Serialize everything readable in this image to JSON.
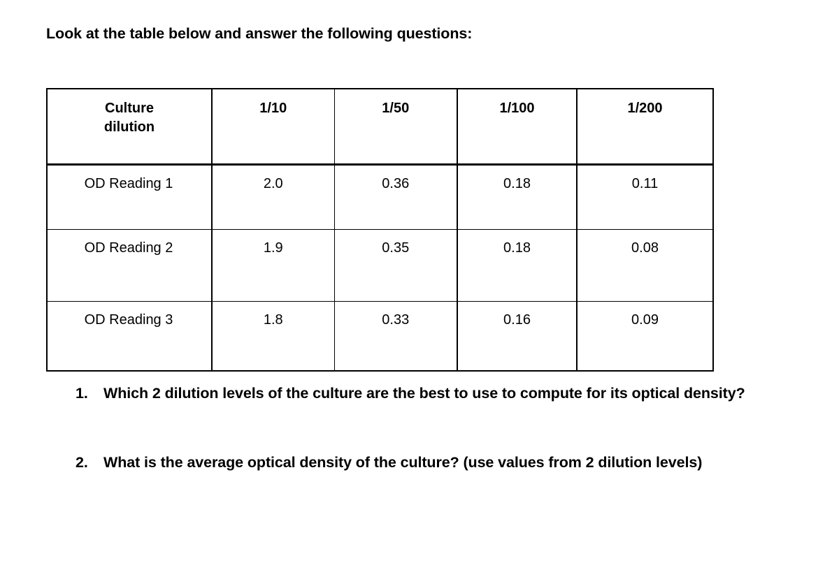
{
  "heading": "Look at the table below and answer the following questions:",
  "table": {
    "columns": [
      "Culture dilution",
      "1/10",
      "1/50",
      "1/100",
      "1/200"
    ],
    "header_col0_line1": "Culture",
    "header_col0_line2": "dilution",
    "rows": [
      {
        "label": "OD Reading 1",
        "values": [
          "2.0",
          "0.36",
          "0.18",
          "0.11"
        ]
      },
      {
        "label": "OD Reading 2",
        "values": [
          "1.9",
          "0.35",
          "0.18",
          "0.08"
        ]
      },
      {
        "label": "OD Reading 3",
        "values": [
          "1.8",
          "0.33",
          "0.16",
          "0.09"
        ]
      }
    ]
  },
  "questions": [
    {
      "number": "1.",
      "text": "Which 2 dilution levels of the culture are the best to use to compute for its optical density?"
    },
    {
      "number": "2.",
      "text": "What is the average optical density of the culture? (use values from 2 dilution levels)"
    }
  ]
}
